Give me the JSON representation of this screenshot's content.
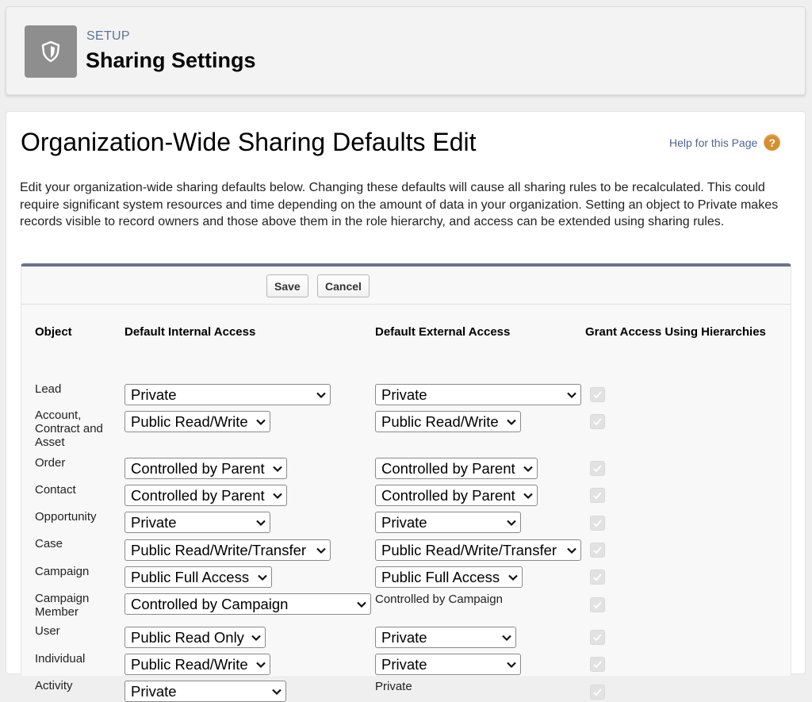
{
  "header": {
    "eyebrow": "SETUP",
    "title": "Sharing Settings",
    "icon": "shield-icon"
  },
  "page": {
    "title": "Organization-Wide Sharing Defaults Edit",
    "help_link": "Help for this Page",
    "help_icon": "?",
    "description": "Edit your organization-wide sharing defaults below. Changing these defaults will cause all sharing rules to be recalculated. This could require significant system resources and time depending on the amount of data in your organization. Setting an object to Private makes records visible to record owners and those above them in the role hierarchy, and access can be extended using sharing rules."
  },
  "toolbar": {
    "save_label": "Save",
    "cancel_label": "Cancel"
  },
  "table": {
    "columns": {
      "object": "Object",
      "internal": "Default Internal Access",
      "external": "Default External Access",
      "hierarchy": "Grant Access Using Hierarchies"
    },
    "rows": [
      {
        "object": "Lead",
        "internal": "Private",
        "external": "Private",
        "external_editable": true,
        "hierarchy_checked": true
      },
      {
        "object": "Account, Contract and Asset",
        "internal": "Public Read/Write",
        "external": "Public Read/Write",
        "external_editable": true,
        "hierarchy_checked": true
      },
      {
        "object": "Order",
        "internal": "Controlled by Parent",
        "external": "Controlled by Parent",
        "external_editable": true,
        "hierarchy_checked": true
      },
      {
        "object": "Contact",
        "internal": "Controlled by Parent",
        "external": "Controlled by Parent",
        "external_editable": true,
        "hierarchy_checked": true
      },
      {
        "object": "Opportunity",
        "internal": "Private",
        "external": "Private",
        "external_editable": true,
        "hierarchy_checked": true
      },
      {
        "object": "Case",
        "internal": "Public Read/Write/Transfer",
        "external": "Public Read/Write/Transfer",
        "external_editable": true,
        "hierarchy_checked": true
      },
      {
        "object": "Campaign",
        "internal": "Public Full Access",
        "external": "Public Full Access",
        "external_editable": true,
        "hierarchy_checked": true
      },
      {
        "object": "Campaign Member",
        "internal": "Controlled by Campaign",
        "external": "Controlled by Campaign",
        "external_editable": false,
        "hierarchy_checked": true
      },
      {
        "object": "User",
        "internal": "Public Read Only",
        "external": "Private",
        "external_editable": true,
        "hierarchy_checked": true
      },
      {
        "object": "Individual",
        "internal": "Public Read/Write",
        "external": "Private",
        "external_editable": true,
        "hierarchy_checked": true
      },
      {
        "object": "Activity",
        "internal": "Private",
        "external": "Private",
        "external_editable": false,
        "hierarchy_checked": true
      }
    ]
  }
}
